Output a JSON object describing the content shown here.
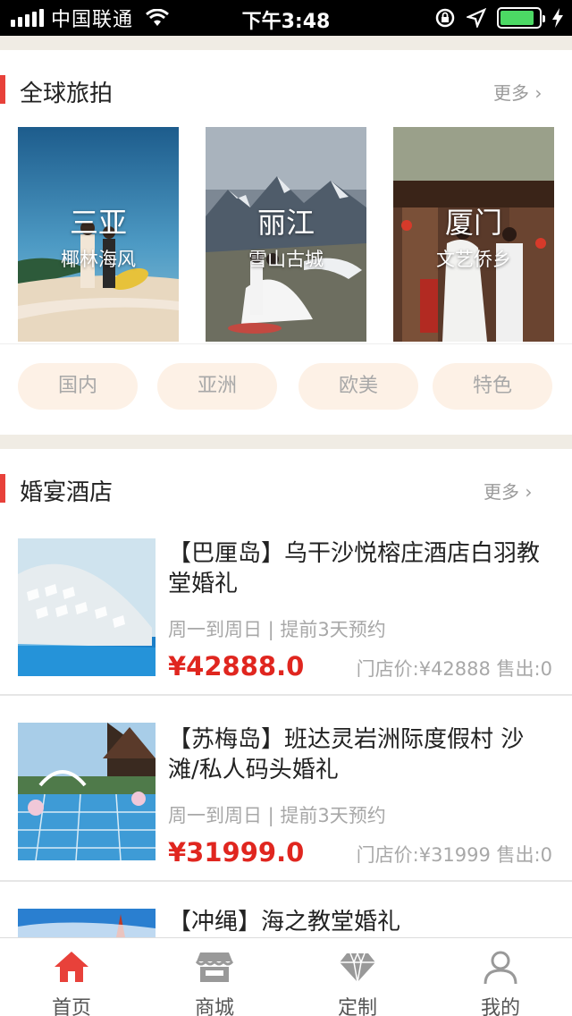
{
  "status_bar": {
    "carrier": "中国联通",
    "time": "下午3:48"
  },
  "travel_section": {
    "title": "全球旅拍",
    "more": "更多 ›",
    "destinations": [
      {
        "city": "三亚",
        "subtitle": "椰林海风"
      },
      {
        "city": "丽江",
        "subtitle": "雪山古城"
      },
      {
        "city": "厦门",
        "subtitle": "文艺侨乡"
      }
    ],
    "filters": [
      "国内",
      "亚洲",
      "欧美",
      "特色"
    ]
  },
  "hotel_section": {
    "title": "婚宴酒店",
    "more": "更多 ›",
    "items": [
      {
        "name": "【巴厘岛】乌干沙悦榕庄酒店白羽教堂婚礼",
        "schedule": "周一到周日 | 提前3天预约",
        "price": "¥42888.0",
        "store": "门店价:¥42888 售出:0"
      },
      {
        "name": "【苏梅岛】班达灵岩洲际度假村 沙滩/私人码头婚礼",
        "schedule": "周一到周日 | 提前3天预约",
        "price": "¥31999.0",
        "store": "门店价:¥31999  售出:0"
      },
      {
        "name": "【冲绳】海之教堂婚礼"
      }
    ]
  },
  "tab_bar": {
    "tabs": [
      {
        "label": "首页",
        "icon": "home-icon",
        "active": true
      },
      {
        "label": "商城",
        "icon": "shop-icon",
        "active": false
      },
      {
        "label": "定制",
        "icon": "diamond-icon",
        "active": false
      },
      {
        "label": "我的",
        "icon": "user-icon",
        "active": false
      }
    ]
  },
  "colors": {
    "accent": "#e8413a",
    "price": "#e0261f",
    "pill_bg": "#fdf1e6",
    "section_gap": "#f0ece4"
  }
}
